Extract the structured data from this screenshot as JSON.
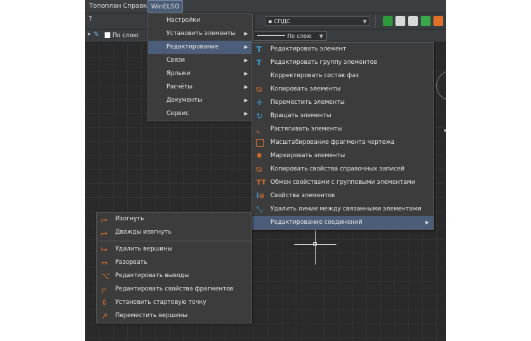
{
  "menubar": {
    "items": [
      "Топоплан",
      "Справка",
      "WinELSO"
    ]
  },
  "toolbar": {
    "help_label": "?",
    "layer_left": "По слою",
    "layer_right": "По слою",
    "style_combo": "СПДС"
  },
  "winelso_menu": {
    "items": [
      {
        "label": "Настройки",
        "has_sub": false
      },
      {
        "label": "Установить элементы",
        "has_sub": true
      },
      {
        "label": "Редактирование",
        "has_sub": true
      },
      {
        "label": "Связи",
        "has_sub": true
      },
      {
        "label": "Ярлыки",
        "has_sub": true
      },
      {
        "label": "Расчёты",
        "has_sub": true
      },
      {
        "label": "Документы",
        "has_sub": true
      },
      {
        "label": "Сервис",
        "has_sub": true
      }
    ]
  },
  "edit_menu": {
    "items": [
      {
        "label": "Редактировать элемент",
        "icon": "edit-element-icon"
      },
      {
        "label": "Редактировать группу элементов",
        "icon": "edit-group-icon"
      },
      {
        "label": "Корректировать состав фаз",
        "icon": ""
      },
      {
        "label": "Копировать элементы",
        "icon": "copy-icon"
      },
      {
        "label": "Переместить элементы",
        "icon": "move-icon"
      },
      {
        "label": "Вращать элементы",
        "icon": "rotate-icon"
      },
      {
        "label": "Растягивать элементы",
        "icon": "stretch-icon"
      },
      {
        "label": "Масштабирование фрагмента чертежа",
        "icon": "scale-icon"
      },
      {
        "label": "Маркировать элементы",
        "icon": "mark-icon"
      },
      {
        "label": "Копировать свойства справочных записей",
        "icon": "copy-props-icon"
      },
      {
        "label": "Обмен свойствами с групповыми элементами",
        "icon": "exchange-props-icon"
      },
      {
        "label": "Свойства элементов",
        "icon": "properties-icon"
      },
      {
        "label": "Удалить линии между связанными элементами",
        "icon": "delete-lines-icon"
      },
      {
        "label": "Редактирование соединений",
        "icon": ""
      }
    ]
  },
  "connections_menu": {
    "group1": [
      {
        "label": "Изогнуть",
        "icon": "bend-icon"
      },
      {
        "label": "Дважды изогнуть",
        "icon": "double-bend-icon"
      }
    ],
    "group2": [
      {
        "label": "Удалить вершины",
        "icon": "delete-vertex-icon"
      },
      {
        "label": "Разорвать",
        "icon": "break-icon"
      },
      {
        "label": "Редактировать выводы",
        "icon": "edit-pins-icon"
      },
      {
        "label": "Редактировать свойства фрагментов",
        "icon": "edit-fragments-icon"
      },
      {
        "label": "Установить стартовую точку",
        "icon": "start-point-icon"
      },
      {
        "label": "Переместить вершины",
        "icon": "move-vertex-icon"
      }
    ]
  },
  "colors": {
    "highlight": "#4b5d79",
    "menu_bg": "#3c3c3c",
    "accent_orange": "#e0702a",
    "accent_blue": "#3a9fd8"
  }
}
